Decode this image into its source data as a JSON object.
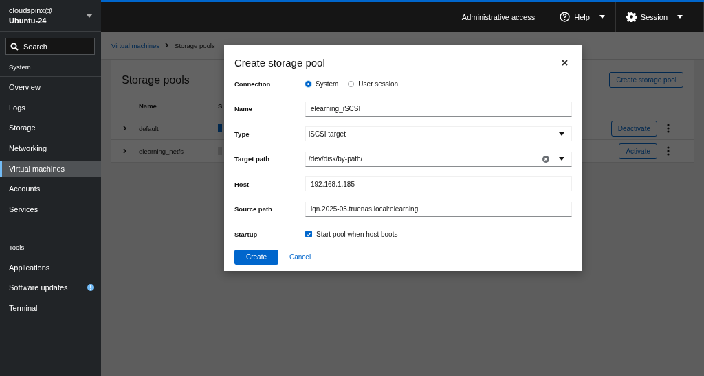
{
  "sidebar": {
    "user": "cloudspinx@",
    "host": "Ubuntu-24",
    "search": {
      "placeholder": "Search"
    },
    "sections": [
      {
        "title": "System",
        "items": [
          {
            "label": "Overview",
            "selected": false,
            "alert": false
          },
          {
            "label": "Logs",
            "selected": false,
            "alert": false
          },
          {
            "label": "Storage",
            "selected": false,
            "alert": false
          },
          {
            "label": "Networking",
            "selected": false,
            "alert": false
          },
          {
            "label": "Virtual machines",
            "selected": true,
            "alert": false
          },
          {
            "label": "Accounts",
            "selected": false,
            "alert": false
          },
          {
            "label": "Services",
            "selected": false,
            "alert": false
          }
        ]
      },
      {
        "title": "Tools",
        "items": [
          {
            "label": "Applications",
            "selected": false,
            "alert": false
          },
          {
            "label": "Software updates",
            "selected": false,
            "alert": true
          },
          {
            "label": "Terminal",
            "selected": false,
            "alert": false
          }
        ]
      }
    ]
  },
  "topbar": {
    "access": "Administrative access",
    "help": "Help",
    "session": "Session"
  },
  "breadcrumb": [
    "Virtual machines",
    "Storage pools"
  ],
  "page": {
    "title": "Storage pools",
    "create_button": "Create storage pool",
    "table": {
      "columns": [
        "Name",
        "S"
      ],
      "rows": [
        {
          "name": "default",
          "active": true,
          "action": "Deactivate"
        },
        {
          "name": "elearning_netfs",
          "active": false,
          "action": "Activate"
        }
      ]
    }
  },
  "dialog": {
    "title": "Create storage pool",
    "fields": [
      {
        "kind": "radio",
        "label": "Connection",
        "options": [
          {
            "label": "System",
            "selected": true
          },
          {
            "label": "User session",
            "selected": false
          }
        ]
      },
      {
        "kind": "text",
        "label": "Name",
        "value": "elearning_iSCSI"
      },
      {
        "kind": "select",
        "label": "Type",
        "value": "iSCSI target"
      },
      {
        "kind": "combo",
        "label": "Target path",
        "value": "/dev/disk/by-path/"
      },
      {
        "kind": "text",
        "label": "Host",
        "value": "192.168.1.185"
      },
      {
        "kind": "text",
        "label": "Source path",
        "value": "iqn.2025-05.truenas.local:elearning"
      },
      {
        "kind": "checkbox",
        "label": "Startup",
        "text": "Start pool when host boots",
        "checked": true
      }
    ],
    "primary": "Create",
    "cancel": "Cancel"
  }
}
